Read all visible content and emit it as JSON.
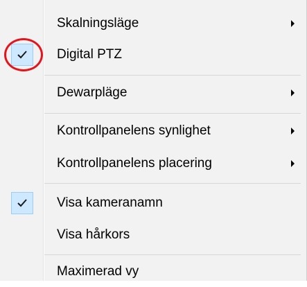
{
  "menu": {
    "items": [
      {
        "label": "Skalningsläge",
        "submenu": true,
        "checked": false
      },
      {
        "label": "Digital PTZ",
        "submenu": false,
        "checked": true,
        "highlighted": true
      },
      {
        "label": "Dewarpläge",
        "submenu": true,
        "checked": false
      },
      {
        "label": "Kontrollpanelens synlighet",
        "submenu": true,
        "checked": false
      },
      {
        "label": "Kontrollpanelens placering",
        "submenu": true,
        "checked": false
      },
      {
        "label": "Visa kameranamn",
        "submenu": false,
        "checked": true
      },
      {
        "label": "Visa hårkors",
        "submenu": false,
        "checked": false
      },
      {
        "label": "Maximerad vy",
        "submenu": false,
        "checked": false
      }
    ]
  },
  "colors": {
    "menu_background": "#f2f2f2",
    "check_highlight": "#cde8ff",
    "annotation_ring": "#e5141b"
  }
}
